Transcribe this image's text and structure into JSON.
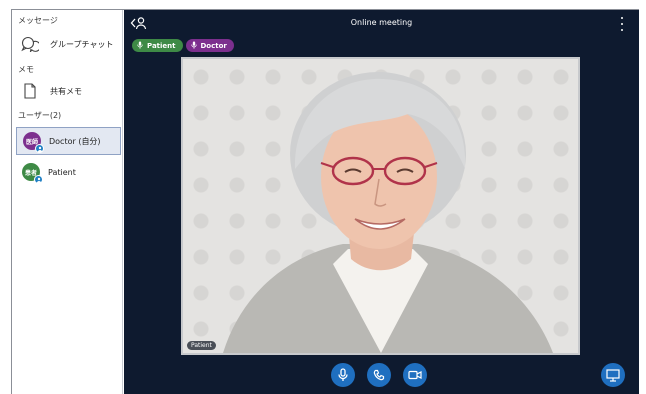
{
  "sidebar": {
    "messages_label": "メッセージ",
    "group_chat_label": "グループチャット",
    "memo_label": "メモ",
    "shared_memo_label": "共有メモ",
    "users_label": "ユーザー(2)",
    "users": [
      {
        "avatar_text": "医師",
        "name": "Doctor (自分)",
        "avatar_color": "#7c2f8e",
        "selected": true
      },
      {
        "avatar_text": "患者",
        "name": "Patient",
        "avatar_color": "#3e8a46",
        "selected": false
      }
    ]
  },
  "header": {
    "title": "Online meeting",
    "back_icon": "leave-user-icon",
    "menu_icon": "more-vertical-icon"
  },
  "participants": [
    {
      "name": "Patient",
      "color": "#3e8a46",
      "icon": "mic-icon"
    },
    {
      "name": "Doctor",
      "color": "#7c2f8e",
      "icon": "mic-icon"
    }
  ],
  "video": {
    "label": "Patient"
  },
  "controls": {
    "mic_icon": "mic-icon",
    "call_icon": "phone-icon",
    "camera_icon": "camera-icon",
    "present_icon": "screen-share-icon"
  },
  "colors": {
    "main_bg": "#0e1a2f",
    "accent": "#1f6fc0"
  }
}
